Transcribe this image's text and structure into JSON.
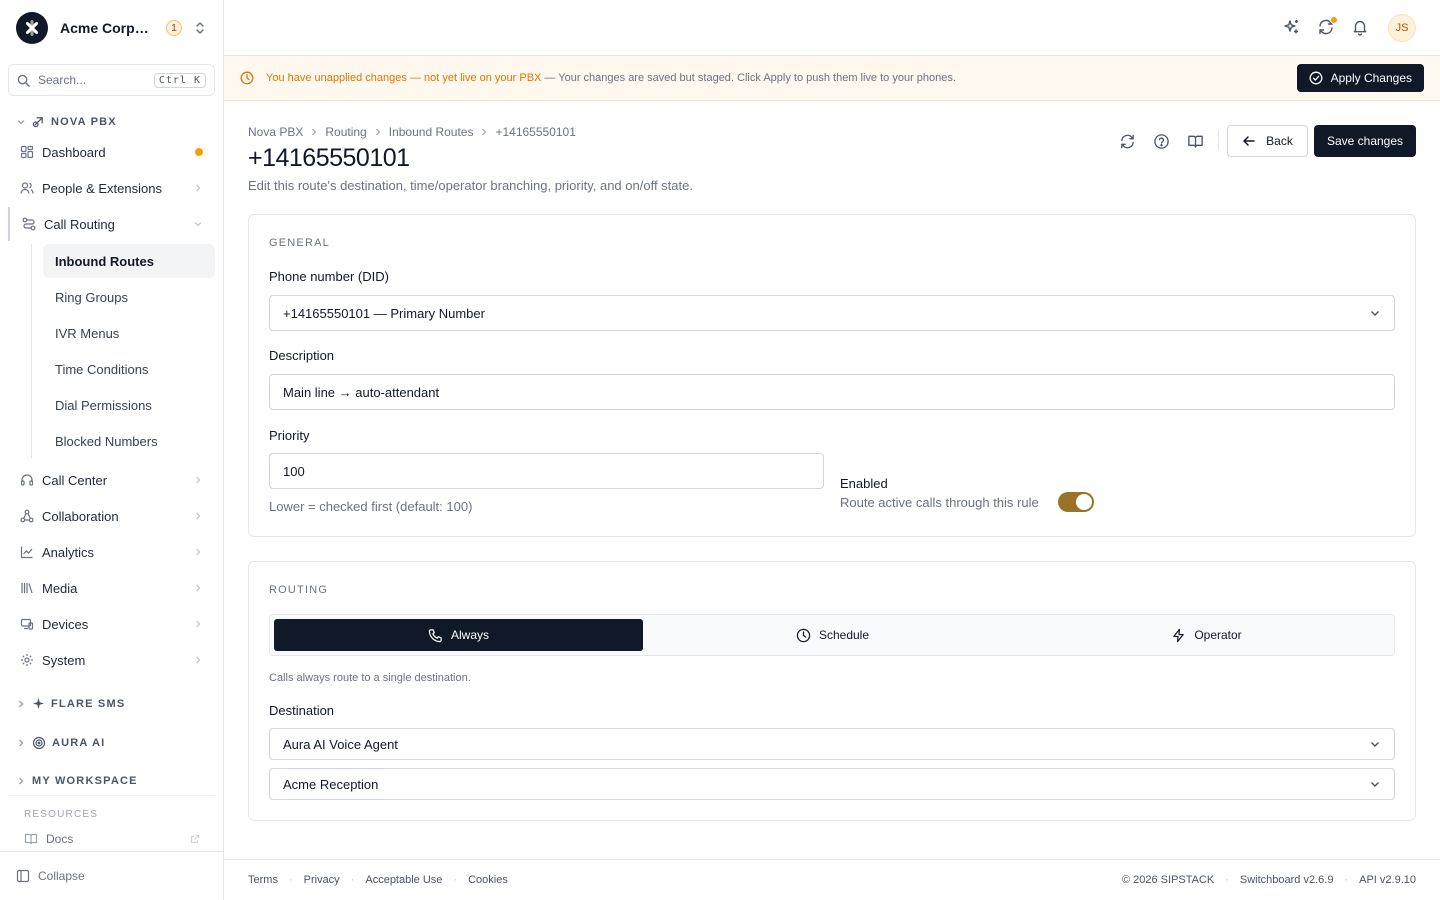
{
  "org": {
    "name": "Acme Corporation",
    "badge": "1"
  },
  "search": {
    "placeholder": "Search...",
    "shortcut": "Ctrl K"
  },
  "sidebar": {
    "group_nova": "NOVA PBX",
    "items": [
      {
        "label": "Dashboard"
      },
      {
        "label": "People & Extensions"
      },
      {
        "label": "Call Routing"
      },
      {
        "label": "Call Center"
      },
      {
        "label": "Collaboration"
      },
      {
        "label": "Analytics"
      },
      {
        "label": "Media"
      },
      {
        "label": "Devices"
      },
      {
        "label": "System"
      }
    ],
    "sub_items": [
      {
        "label": "Inbound Routes"
      },
      {
        "label": "Ring Groups"
      },
      {
        "label": "IVR Menus"
      },
      {
        "label": "Time Conditions"
      },
      {
        "label": "Dial Permissions"
      },
      {
        "label": "Blocked Numbers"
      }
    ],
    "group_flare": "FLARE SMS",
    "group_aura": "AURA AI",
    "group_workspace": "MY WORKSPACE",
    "resources_label": "RESOURCES",
    "docs_label": "Docs",
    "collapse_label": "Collapse"
  },
  "topbar": {
    "avatar_initials": "JS"
  },
  "banner": {
    "strong": "You have unapplied changes — not yet live on your PBX",
    "rest": "— Your changes are saved but staged. Click Apply to push them live to your phones.",
    "apply_label": "Apply Changes"
  },
  "breadcrumb": [
    "Nova PBX",
    "Routing",
    "Inbound Routes",
    "+14165550101"
  ],
  "page": {
    "title": "+14165550101",
    "subtitle": "Edit this route's destination, time/operator branching, priority, and on/off state.",
    "back_label": "Back",
    "save_label": "Save changes"
  },
  "general": {
    "title": "GENERAL",
    "did_label": "Phone number (DID)",
    "did_value": "+14165550101 — Primary Number",
    "description_label": "Description",
    "description_value": "Main line → auto-attendant",
    "priority_label": "Priority",
    "priority_value": "100",
    "priority_hint": "Lower = checked first (default: 100)",
    "enabled_label": "Enabled",
    "enabled_desc": "Route active calls through this rule",
    "enabled": true
  },
  "routing": {
    "title": "ROUTING",
    "tabs": [
      {
        "label": "Always",
        "active": true
      },
      {
        "label": "Schedule",
        "active": false
      },
      {
        "label": "Operator",
        "active": false
      }
    ],
    "desc": "Calls always route to a single destination.",
    "destination_label": "Destination",
    "destination_type": "Aura AI Voice Agent",
    "destination_target": "Acme Reception"
  },
  "footer": {
    "links": [
      "Terms",
      "Privacy",
      "Acceptable Use",
      "Cookies"
    ],
    "copyright": "© 2026 SIPSTACK",
    "version": "Switchboard v2.6.9",
    "api": "API v2.9.10"
  },
  "colors": {
    "accent_warning": "#d97706",
    "primary": "#111827",
    "toggle_on": "#9a7328"
  }
}
